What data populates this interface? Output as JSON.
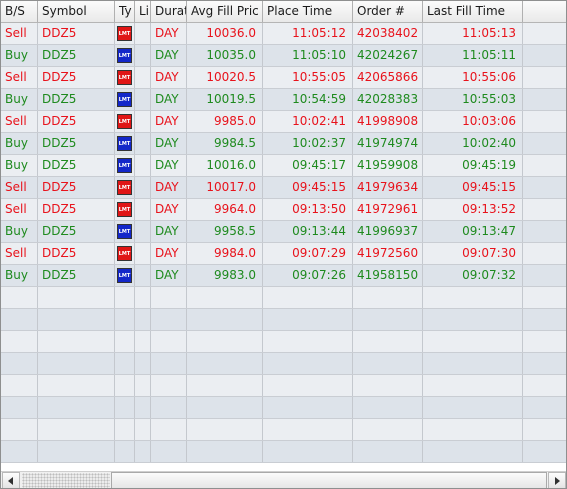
{
  "columns": [
    {
      "key": "bs",
      "label": "B/S"
    },
    {
      "key": "symbol",
      "label": "Symbol"
    },
    {
      "key": "type",
      "label": "Ty"
    },
    {
      "key": "limit",
      "label": "Li"
    },
    {
      "key": "duration",
      "label": "Durat"
    },
    {
      "key": "avg_fill_price",
      "label": "Avg Fill Pric"
    },
    {
      "key": "place_time",
      "label": "Place Time"
    },
    {
      "key": "order_no",
      "label": "Order #"
    },
    {
      "key": "last_fill_time",
      "label": "Last Fill Time"
    }
  ],
  "type_badge_label": "LMT",
  "colors": {
    "sell": "#e8121b",
    "buy": "#1e8a1e",
    "badge_sell": "#e01515",
    "badge_buy": "#1327c9"
  },
  "rows": [
    {
      "bs": "Sell",
      "symbol": "DDZ5",
      "type_icon": "lmt-red-icon",
      "limit": "",
      "duration": "DAY",
      "avg_fill_price": "10036.0",
      "place_time": "11:05:12",
      "order_no": "42038402",
      "last_fill_time": "11:05:13"
    },
    {
      "bs": "Buy",
      "symbol": "DDZ5",
      "type_icon": "lmt-blue-icon",
      "limit": "",
      "duration": "DAY",
      "avg_fill_price": "10035.0",
      "place_time": "11:05:10",
      "order_no": "42024267",
      "last_fill_time": "11:05:11"
    },
    {
      "bs": "Sell",
      "symbol": "DDZ5",
      "type_icon": "lmt-red-icon",
      "limit": "",
      "duration": "DAY",
      "avg_fill_price": "10020.5",
      "place_time": "10:55:05",
      "order_no": "42065866",
      "last_fill_time": "10:55:06"
    },
    {
      "bs": "Buy",
      "symbol": "DDZ5",
      "type_icon": "lmt-blue-icon",
      "limit": "",
      "duration": "DAY",
      "avg_fill_price": "10019.5",
      "place_time": "10:54:59",
      "order_no": "42028383",
      "last_fill_time": "10:55:03"
    },
    {
      "bs": "Sell",
      "symbol": "DDZ5",
      "type_icon": "lmt-red-icon",
      "limit": "",
      "duration": "DAY",
      "avg_fill_price": "9985.0",
      "place_time": "10:02:41",
      "order_no": "41998908",
      "last_fill_time": "10:03:06"
    },
    {
      "bs": "Buy",
      "symbol": "DDZ5",
      "type_icon": "lmt-blue-icon",
      "limit": "",
      "duration": "DAY",
      "avg_fill_price": "9984.5",
      "place_time": "10:02:37",
      "order_no": "41974974",
      "last_fill_time": "10:02:40"
    },
    {
      "bs": "Buy",
      "symbol": "DDZ5",
      "type_icon": "lmt-blue-icon",
      "limit": "",
      "duration": "DAY",
      "avg_fill_price": "10016.0",
      "place_time": "09:45:17",
      "order_no": "41959908",
      "last_fill_time": "09:45:19"
    },
    {
      "bs": "Sell",
      "symbol": "DDZ5",
      "type_icon": "lmt-red-icon",
      "limit": "",
      "duration": "DAY",
      "avg_fill_price": "10017.0",
      "place_time": "09:45:15",
      "order_no": "41979634",
      "last_fill_time": "09:45:15"
    },
    {
      "bs": "Sell",
      "symbol": "DDZ5",
      "type_icon": "lmt-red-icon",
      "limit": "",
      "duration": "DAY",
      "avg_fill_price": "9964.0",
      "place_time": "09:13:50",
      "order_no": "41972961",
      "last_fill_time": "09:13:52"
    },
    {
      "bs": "Buy",
      "symbol": "DDZ5",
      "type_icon": "lmt-blue-icon",
      "limit": "",
      "duration": "DAY",
      "avg_fill_price": "9958.5",
      "place_time": "09:13:44",
      "order_no": "41996937",
      "last_fill_time": "09:13:47"
    },
    {
      "bs": "Sell",
      "symbol": "DDZ5",
      "type_icon": "lmt-red-icon",
      "limit": "",
      "duration": "DAY",
      "avg_fill_price": "9984.0",
      "place_time": "09:07:29",
      "order_no": "41972560",
      "last_fill_time": "09:07:30"
    },
    {
      "bs": "Buy",
      "symbol": "DDZ5",
      "type_icon": "lmt-blue-icon",
      "limit": "",
      "duration": "DAY",
      "avg_fill_price": "9983.0",
      "place_time": "09:07:26",
      "order_no": "41958150",
      "last_fill_time": "09:07:32"
    }
  ],
  "scrollbar": {
    "left_icon": "arrow-left-icon",
    "right_icon": "arrow-right-icon"
  }
}
